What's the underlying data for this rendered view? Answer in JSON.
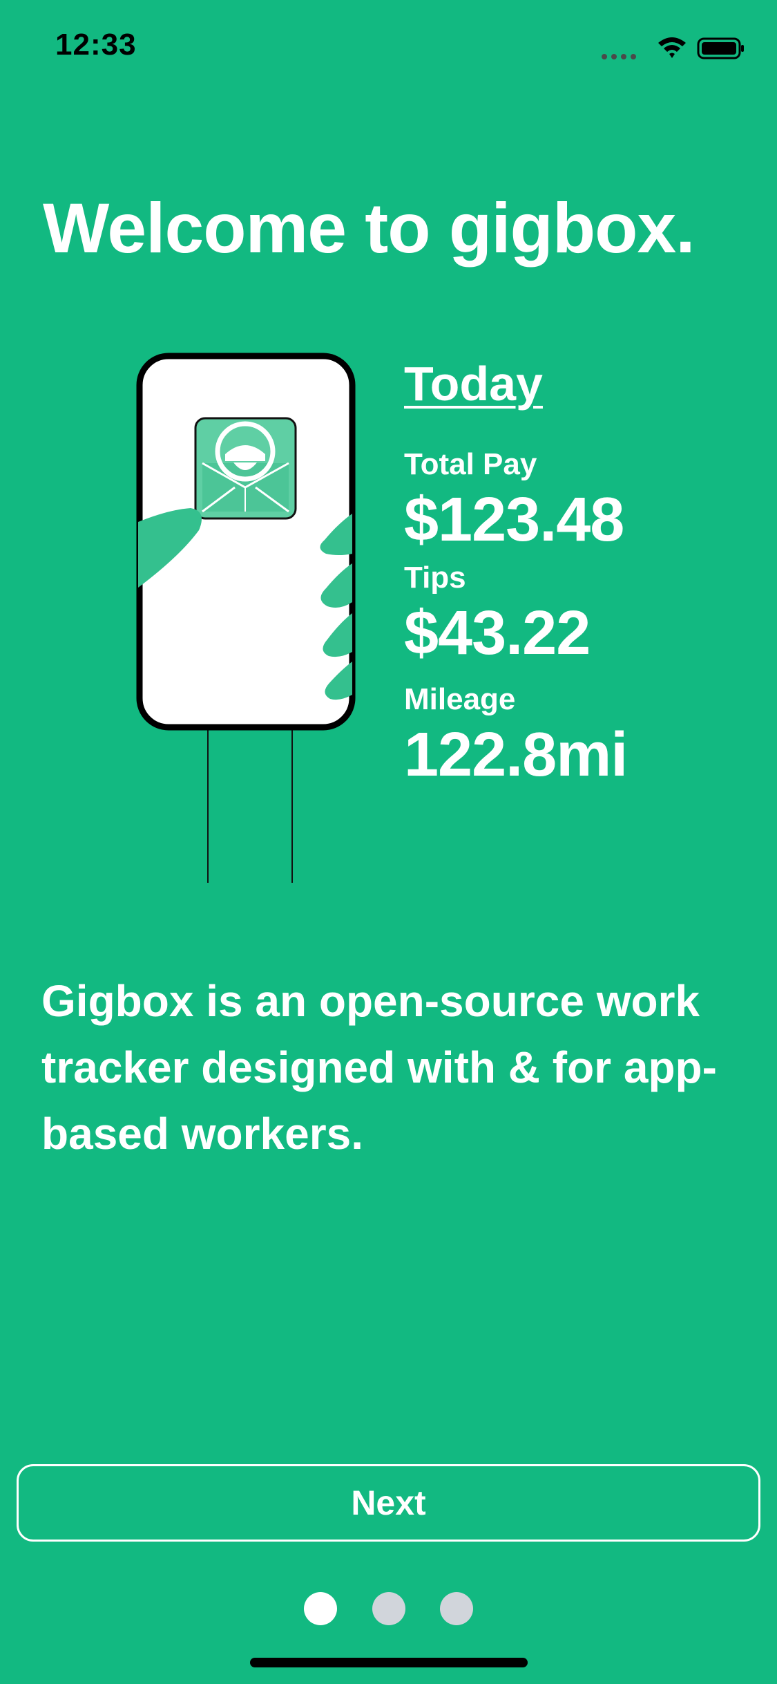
{
  "status_bar": {
    "time": "12:33",
    "icons": [
      "signal-dots-icon",
      "wifi-icon",
      "battery-icon"
    ]
  },
  "onboarding": {
    "title": "Welcome to gigbox.",
    "description": "Gigbox is an open-source work tracker designed with & for app-based workers."
  },
  "stats": {
    "heading": "Today",
    "total_pay_label": "Total Pay",
    "total_pay_value": "$123.48",
    "tips_label": "Tips",
    "tips_value": "$43.22",
    "mileage_label": "Mileage",
    "mileage_value": "122.8mi"
  },
  "buttons": {
    "next_label": "Next"
  },
  "pagination": {
    "total_pages": 3,
    "current_page": 1
  },
  "colors": {
    "background": "#12B981",
    "accent_hand": "#34C08E",
    "dot_inactive": "#D1D5DB",
    "dot_active": "#FFFFFF",
    "text": "#FFFFFF"
  }
}
